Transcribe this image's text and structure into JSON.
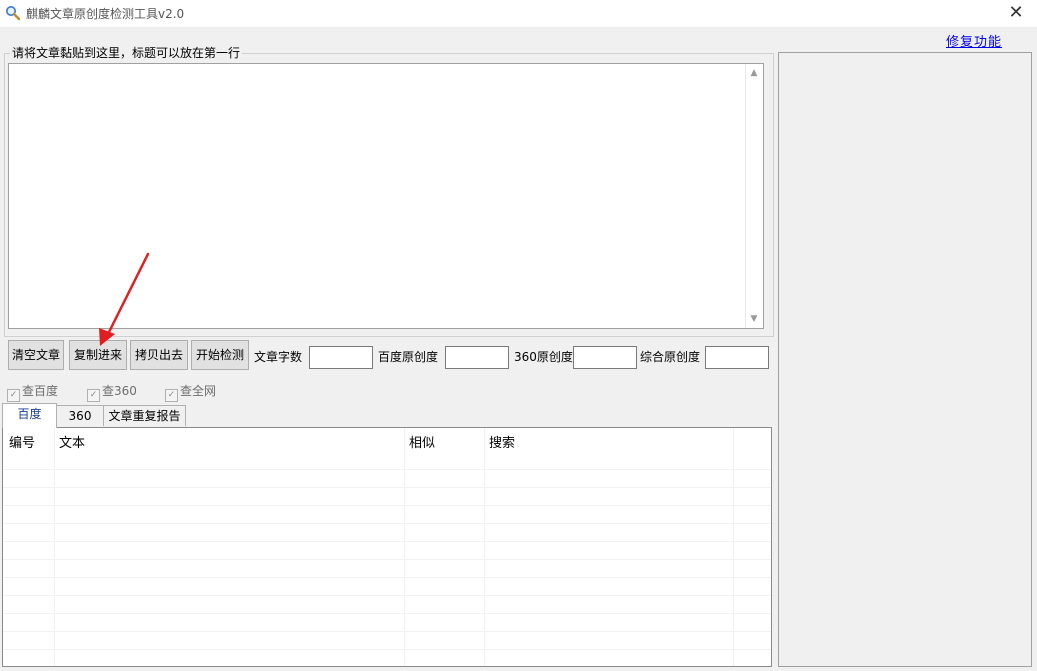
{
  "window": {
    "title": "麒麟文章原创度检测工具v2.0",
    "close_glyph": "✕"
  },
  "repair_link": "修复功能",
  "input_group": {
    "label": "请将文章黏贴到这里，标题可以放在第一行",
    "content": ""
  },
  "buttons": {
    "clear": "清空文章",
    "paste_in": "复制进来",
    "copy_out": "拷贝出去",
    "start": "开始检测"
  },
  "stats": {
    "word_count_label": "文章字数",
    "word_count": "",
    "baidu_label": "百度原创度",
    "baidu": "",
    "s360_label": "360原创度",
    "s360": "",
    "overall_label": "综合原创度",
    "overall": ""
  },
  "checks": [
    {
      "label": "查百度",
      "checked": true
    },
    {
      "label": "查360",
      "checked": true
    },
    {
      "label": "查全网",
      "checked": true
    }
  ],
  "tabs": [
    {
      "label": "百度",
      "active": true
    },
    {
      "label": "360",
      "active": false
    },
    {
      "label": "文章重复报告",
      "active": false
    }
  ],
  "table": {
    "columns": [
      "编号",
      "文本",
      "相似",
      "搜索"
    ],
    "rows": []
  },
  "colors": {
    "link": "#0000ee",
    "active_tab": "#1a3a8f"
  }
}
